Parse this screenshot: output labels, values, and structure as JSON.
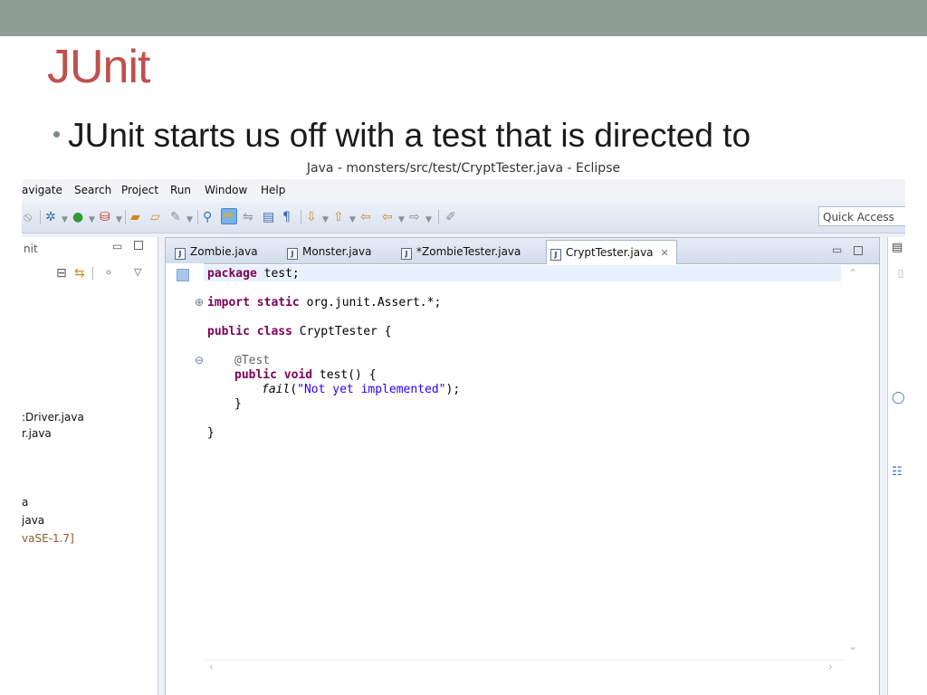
{
  "slide": {
    "title": "JUnit",
    "bullet": "JUnit starts us off with a test that is directed to"
  },
  "window": {
    "title": "Java - monsters/src/test/CryptTester.java - Eclipse"
  },
  "menu": {
    "navigate": "avigate",
    "search": "Search",
    "project": "Project",
    "run": "Run",
    "window": "Window",
    "help": "Help"
  },
  "toolbar": {
    "quick_access_placeholder": "Quick Access"
  },
  "left_panel": {
    "title": "nit",
    "items": [
      ":Driver.java",
      "r.java",
      "a",
      "java",
      "vaSE-1.7]"
    ]
  },
  "editor": {
    "tabs": [
      {
        "label": "Zombie.java",
        "active": false
      },
      {
        "label": "Monster.java",
        "active": false
      },
      {
        "label": "*ZombieTester.java",
        "active": false
      },
      {
        "label": "CryptTester.java",
        "active": true
      }
    ],
    "code": {
      "line1_kw": "package",
      "line1_rest": " test;",
      "line2_kw": "import static",
      "line2_rest": " org.junit.Assert.*;",
      "line3_kw": "public class",
      "line3_rest": " CryptTester {",
      "line4_ann": "@Test",
      "line5_kw": "public void",
      "line5_rest": " test() {",
      "line6_call": "fail",
      "line6_open": "(",
      "line6_str": "\"Not yet implemented\"",
      "line6_close": ");",
      "line7": "}",
      "line8": "}"
    }
  },
  "colors": {
    "title_red": "#c0504d",
    "topbar": "#8e9e96",
    "keyword": "#7f0055",
    "string": "#2a00ff"
  }
}
